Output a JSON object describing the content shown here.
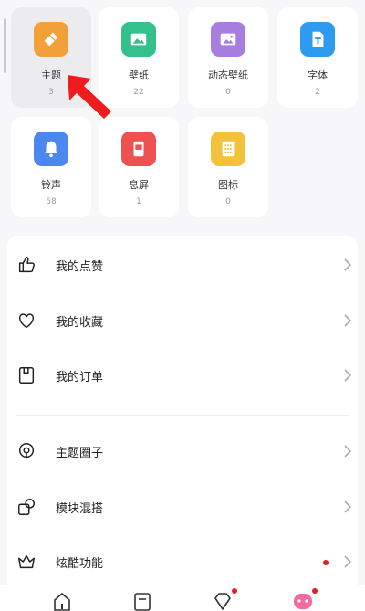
{
  "tiles": [
    {
      "label": "主题",
      "count": "3",
      "color": "#f2a13a",
      "icon": "theme-brush-icon"
    },
    {
      "label": "壁纸",
      "count": "22",
      "color": "#33c08a",
      "icon": "wallpaper-icon"
    },
    {
      "label": "动态壁纸",
      "count": "0",
      "color": "#a77ee0",
      "icon": "live-wallpaper-icon"
    },
    {
      "label": "字体",
      "count": "2",
      "color": "#2d9bf0",
      "icon": "font-icon"
    },
    {
      "label": "铃声",
      "count": "58",
      "color": "#4c87f0",
      "icon": "bell-icon"
    },
    {
      "label": "息屏",
      "count": "1",
      "color": "#ef5050",
      "icon": "aod-icon"
    },
    {
      "label": "图标",
      "count": "0",
      "color": "#f2c23a",
      "icon": "icon-grid-icon"
    }
  ],
  "menu": [
    {
      "label": "我的点赞",
      "icon": "thumbs-up-icon"
    },
    {
      "label": "我的收藏",
      "icon": "heart-icon"
    },
    {
      "label": "我的订单",
      "icon": "order-icon"
    },
    {
      "label": "主题圈子",
      "icon": "circle-community-icon"
    },
    {
      "label": "模块混搭",
      "icon": "module-mix-icon"
    },
    {
      "label": "炫酷功能",
      "icon": "crown-icon",
      "badge": true
    }
  ],
  "tabbar": [
    "home-icon",
    "bookmark-icon",
    "diamond-icon",
    "profile-icon"
  ]
}
